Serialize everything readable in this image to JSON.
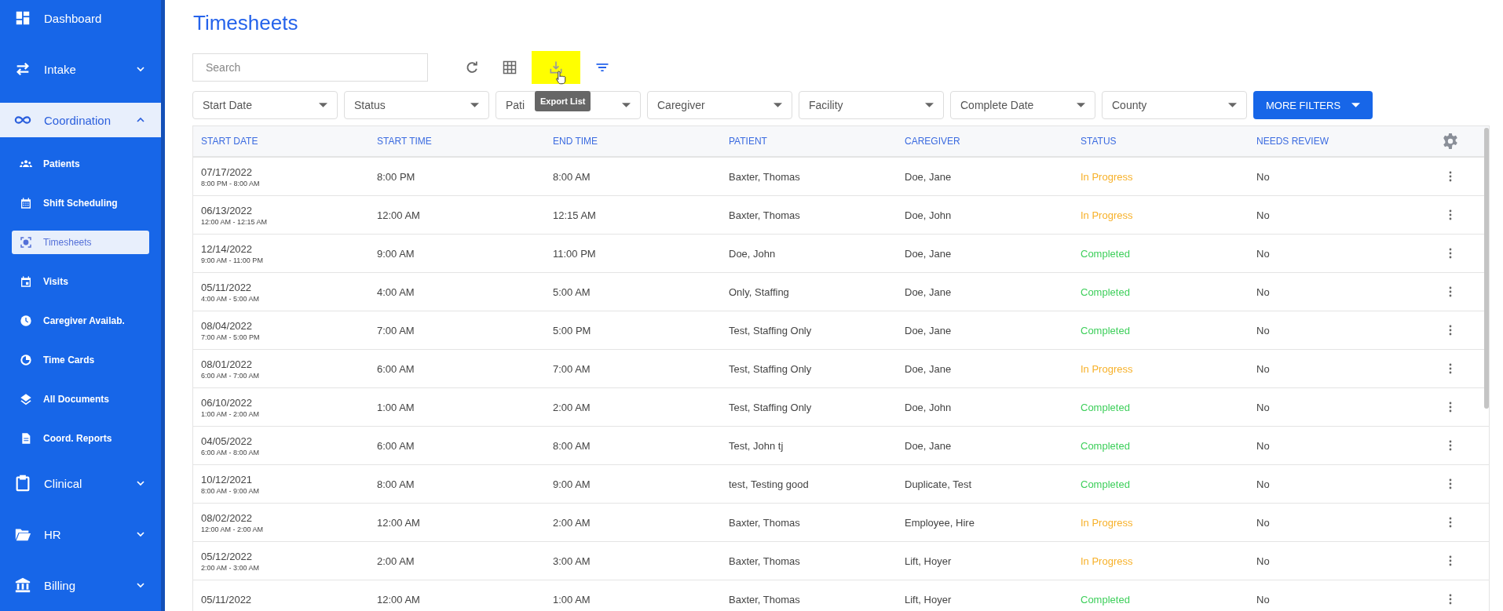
{
  "sidebar": {
    "sections": [
      {
        "label": "Dashboard",
        "kind": "link"
      },
      {
        "label": "Intake",
        "kind": "group",
        "expanded": false,
        "selected": false
      },
      {
        "label": "Coordination",
        "kind": "group",
        "expanded": true,
        "selected": true,
        "children": [
          {
            "label": "Patients",
            "selected": false
          },
          {
            "label": "Shift Scheduling",
            "selected": false
          },
          {
            "label": "Timesheets",
            "selected": true
          },
          {
            "label": "Visits",
            "selected": false
          },
          {
            "label": "Caregiver Availab.",
            "selected": false
          },
          {
            "label": "Time Cards",
            "selected": false
          },
          {
            "label": "All Documents",
            "selected": false
          },
          {
            "label": "Coord. Reports",
            "selected": false
          }
        ]
      },
      {
        "label": "Clinical",
        "kind": "group",
        "expanded": false,
        "selected": false
      },
      {
        "label": "HR",
        "kind": "group",
        "expanded": false,
        "selected": false
      },
      {
        "label": "Billing",
        "kind": "group",
        "expanded": false,
        "selected": false
      }
    ]
  },
  "page_title": "Timesheets",
  "search": {
    "placeholder": "Search"
  },
  "toolbar": {
    "buttons": [
      {
        "highlighted": false
      },
      {
        "highlighted": false
      },
      {
        "highlighted": true
      },
      {
        "highlighted": false
      }
    ],
    "tooltip": "Export List"
  },
  "filters": [
    "Start Date",
    "Status",
    "Pati",
    "Caregiver",
    "Facility",
    "Complete Date",
    "County"
  ],
  "more_filters": "MORE FILTERS",
  "table": {
    "columns": [
      "START DATE",
      "START TIME",
      "END TIME",
      "PATIENT",
      "CAREGIVER",
      "STATUS",
      "NEEDS REVIEW"
    ],
    "rows": [
      {
        "date": "07/17/2022",
        "range": "8:00 PM - 8:00 AM",
        "start": "8:00 PM",
        "end": "8:00 AM",
        "patient": "Baxter, Thomas",
        "caregiver": "Doe, Jane",
        "status": {
          "text": "In Progress",
          "color": "#f7b12a"
        },
        "review": "No"
      },
      {
        "date": "06/13/2022",
        "range": "12:00 AM - 12:15 AM",
        "start": "12:00 AM",
        "end": "12:15 AM",
        "patient": "Baxter, Thomas",
        "caregiver": "Doe, John",
        "status": {
          "text": "In Progress",
          "color": "#f7b12a"
        },
        "review": "No"
      },
      {
        "date": "12/14/2022",
        "range": "9:00 AM - 11:00 PM",
        "start": "9:00 AM",
        "end": "11:00 PM",
        "patient": "Doe, John",
        "caregiver": "Doe, Jane",
        "status": {
          "text": "Completed",
          "color": "#3ecf5b"
        },
        "review": "No"
      },
      {
        "date": "05/11/2022",
        "range": "4:00 AM - 5:00 AM",
        "start": "4:00 AM",
        "end": "5:00 AM",
        "patient": "Only, Staffing",
        "caregiver": "Doe, Jane",
        "status": {
          "text": "Completed",
          "color": "#3ecf5b"
        },
        "review": "No"
      },
      {
        "date": "08/04/2022",
        "range": "7:00 AM - 5:00 PM",
        "start": "7:00 AM",
        "end": "5:00 PM",
        "patient": "Test, Staffing Only",
        "caregiver": "Doe, Jane",
        "status": {
          "text": "Completed",
          "color": "#3ecf5b"
        },
        "review": "No"
      },
      {
        "date": "08/01/2022",
        "range": "6:00 AM - 7:00 AM",
        "start": "6:00 AM",
        "end": "7:00 AM",
        "patient": "Test, Staffing Only",
        "caregiver": "Doe, Jane",
        "status": {
          "text": "In Progress",
          "color": "#f7b12a"
        },
        "review": "No"
      },
      {
        "date": "06/10/2022",
        "range": "1:00 AM - 2:00 AM",
        "start": "1:00 AM",
        "end": "2:00 AM",
        "patient": "Test, Staffing Only",
        "caregiver": "Doe, John",
        "status": {
          "text": "Completed",
          "color": "#3ecf5b"
        },
        "review": "No"
      },
      {
        "date": "04/05/2022",
        "range": "6:00 AM - 8:00 AM",
        "start": "6:00 AM",
        "end": "8:00 AM",
        "patient": "Test, John tj",
        "caregiver": "Doe, Jane",
        "status": {
          "text": "Completed",
          "color": "#3ecf5b"
        },
        "review": "No"
      },
      {
        "date": "10/12/2021",
        "range": "8:00 AM - 9:00 AM",
        "start": "8:00 AM",
        "end": "9:00 AM",
        "patient": "test, Testing good",
        "caregiver": "Duplicate, Test",
        "status": {
          "text": "Completed",
          "color": "#3ecf5b"
        },
        "review": "No"
      },
      {
        "date": "08/02/2022",
        "range": "12:00 AM - 2:00 AM",
        "start": "12:00 AM",
        "end": "2:00 AM",
        "patient": "Baxter, Thomas",
        "caregiver": "Employee, Hire",
        "status": {
          "text": "In Progress",
          "color": "#f7b12a"
        },
        "review": "No"
      },
      {
        "date": "05/12/2022",
        "range": "2:00 AM - 3:00 AM",
        "start": "2:00 AM",
        "end": "3:00 AM",
        "patient": "Baxter, Thomas",
        "caregiver": "Lift, Hoyer",
        "status": {
          "text": "In Progress",
          "color": "#f7b12a"
        },
        "review": "No"
      },
      {
        "date": "05/11/2022",
        "start": "12:00 AM",
        "end": "1:00 AM",
        "patient": "Baxter, Thomas",
        "caregiver": "Lift, Hoyer",
        "status": {
          "text": "Completed",
          "color": "#3ecf5b"
        },
        "review": "No"
      }
    ]
  }
}
